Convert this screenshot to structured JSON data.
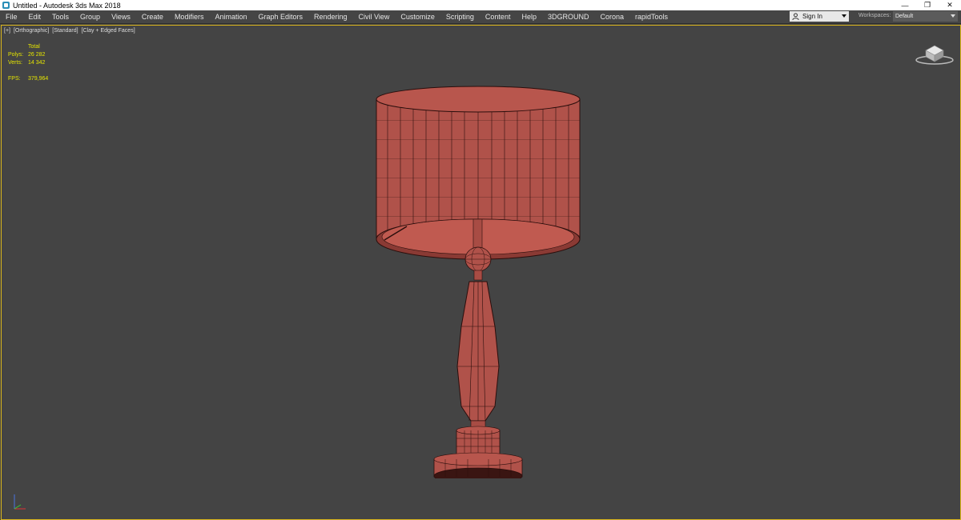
{
  "window": {
    "title": "Untitled - Autodesk 3ds Max 2018"
  },
  "menu": [
    "File",
    "Edit",
    "Tools",
    "Group",
    "Views",
    "Create",
    "Modifiers",
    "Animation",
    "Graph Editors",
    "Rendering",
    "Civil View",
    "Customize",
    "Scripting",
    "Content",
    "Help",
    "3DGROUND",
    "Corona",
    "rapidTools"
  ],
  "signin": {
    "label": "Sign In"
  },
  "workspaces": {
    "label": "Workspaces:",
    "value": "Default"
  },
  "viewport": {
    "labels": [
      "[+]",
      "[Orthographic]",
      "[Standard]",
      "[Clay + Edged Faces]"
    ],
    "stats": {
      "header": "Total",
      "polys_label": "Polys:",
      "polys_value": "26 282",
      "verts_label": "Verts:",
      "verts_value": "14 342",
      "fps_label": "FPS:",
      "fps_value": "379,964"
    }
  },
  "colors": {
    "accent_border": "#d9b51c",
    "clay": "#b0524a",
    "wire": "#2a0e0c",
    "stats_text": "#e5e500"
  }
}
